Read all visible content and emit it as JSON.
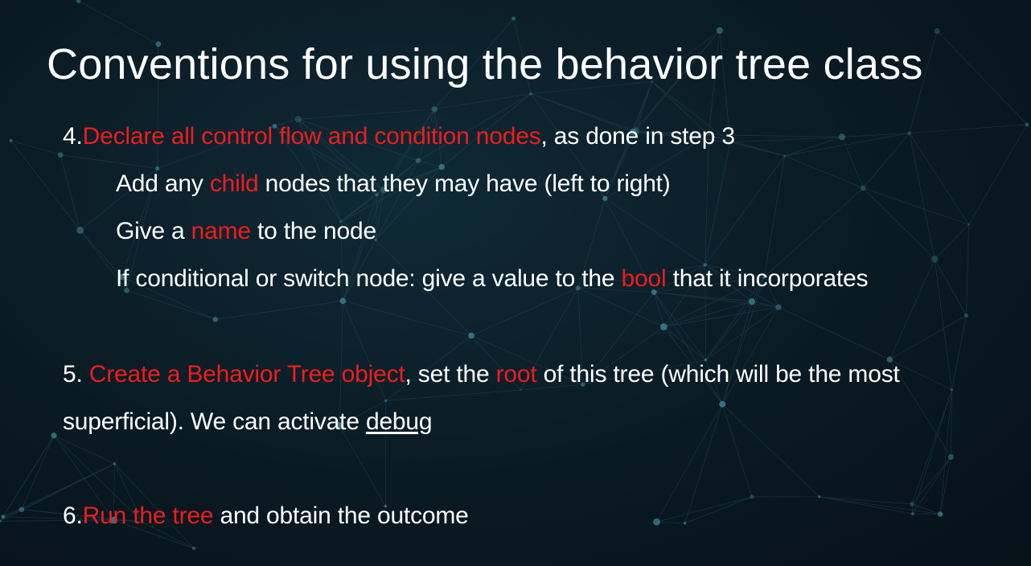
{
  "slide": {
    "title": "Conventions for using the behavior tree class",
    "colors": {
      "accent": "#f01c1c",
      "text": "#ffffff",
      "background": "#0b1c25"
    },
    "step4": {
      "number": "4.",
      "highlight": "Declare all control flow and condition nodes",
      "rest": ", as done in step 3",
      "sub": [
        {
          "pre": "Add any ",
          "highlight": "child",
          "post": " nodes that they may have (left to right)"
        },
        {
          "pre": "Give a ",
          "highlight": "name",
          "post": " to the node"
        },
        {
          "pre": "If conditional or switch node: give a value to the ",
          "highlight": "bool",
          "post": " that it incorporates"
        }
      ]
    },
    "step5": {
      "number": "5. ",
      "highlight1": "Create a Behavior Tree object",
      "mid": ", set the ",
      "highlight2": "root",
      "post": " of this tree (which will be the most",
      "line2": "superficial).  We can activate ",
      "link": "debug"
    },
    "step6": {
      "number": "6.",
      "highlight": "Run the tree",
      "rest": " and obtain the outcome"
    }
  }
}
